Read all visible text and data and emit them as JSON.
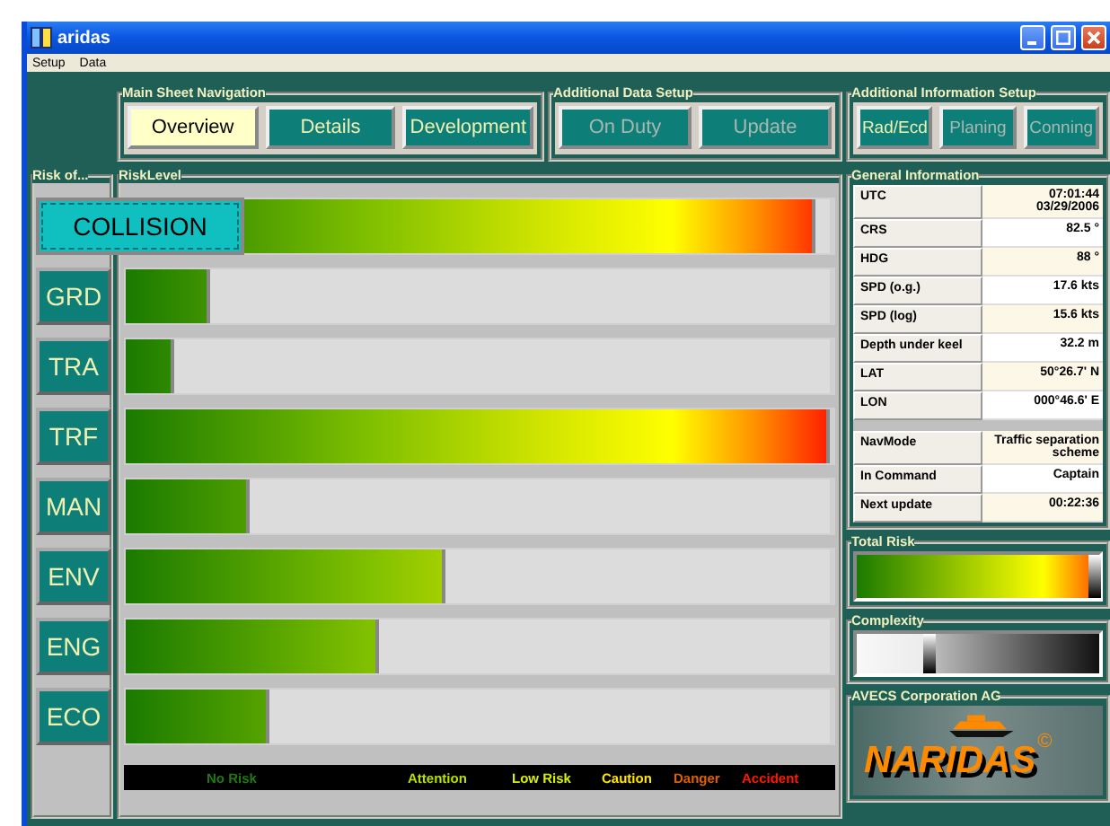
{
  "window": {
    "title": "aridas"
  },
  "menu": [
    "Setup",
    "Data"
  ],
  "nav_groups": [
    {
      "title": "Main Sheet Navigation",
      "buttons": [
        {
          "label": "Overview",
          "selected": true,
          "disabled": false
        },
        {
          "label": "Details",
          "selected": false,
          "disabled": false
        },
        {
          "label": "Development",
          "selected": false,
          "disabled": false
        }
      ]
    },
    {
      "title": "Additional Data Setup",
      "buttons": [
        {
          "label": "On Duty",
          "selected": false,
          "disabled": true
        },
        {
          "label": "Update",
          "selected": false,
          "disabled": true
        }
      ]
    },
    {
      "title": "Additional Information Setup",
      "buttons": [
        {
          "label": "Rad/Ecd",
          "selected": false,
          "disabled": false
        },
        {
          "label": "Planing",
          "selected": false,
          "disabled": true
        },
        {
          "label": "Conning",
          "selected": false,
          "disabled": true
        }
      ]
    }
  ],
  "risk_of": {
    "title": "Risk of..."
  },
  "risk_level": {
    "title": "RiskLevel"
  },
  "risks": [
    {
      "label": "COLLISION",
      "selected": true,
      "level": 0.98
    },
    {
      "label": "GRD",
      "selected": false,
      "level": 0.12
    },
    {
      "label": "TRA",
      "selected": false,
      "level": 0.07
    },
    {
      "label": "TRF",
      "selected": false,
      "level": 1.0
    },
    {
      "label": "MAN",
      "selected": false,
      "level": 0.175
    },
    {
      "label": "ENV",
      "selected": false,
      "level": 0.455
    },
    {
      "label": "ENG",
      "selected": false,
      "level": 0.36
    },
    {
      "label": "ECO",
      "selected": false,
      "level": 0.205
    }
  ],
  "legend": [
    {
      "label": "No Risk",
      "color": "#1f7a12"
    },
    {
      "label": "Attention",
      "color": "#b8e000"
    },
    {
      "label": "Low Risk",
      "color": "#d8f000"
    },
    {
      "label": "Caution",
      "color": "#ffe600"
    },
    {
      "label": "Danger",
      "color": "#e06000"
    },
    {
      "label": "Accident",
      "color": "#ff1a00"
    }
  ],
  "general_information": {
    "title": "General Information",
    "sections": [
      [
        {
          "label": "UTC",
          "value": "07:01:44 03/29/2006"
        },
        {
          "label": "CRS",
          "value": "82.5 °"
        },
        {
          "label": "HDG",
          "value": "88 °"
        },
        {
          "label": "SPD (o.g.)",
          "value": "17.6 kts"
        },
        {
          "label": "SPD (log)",
          "value": "15.6 kts"
        },
        {
          "label": "Depth under keel",
          "value": "32.2 m"
        },
        {
          "label": "LAT",
          "value": "50°26.7' N"
        },
        {
          "label": "LON",
          "value": "000°46.6' E"
        }
      ],
      [
        {
          "label": "NavMode",
          "value": "Traffic separation scheme"
        },
        {
          "label": "In Command",
          "value": "Captain"
        },
        {
          "label": "Next update",
          "value": "00:22:36"
        }
      ]
    ]
  },
  "total_risk": {
    "title": "Total Risk",
    "level": 0.96
  },
  "complexity": {
    "title": "Complexity",
    "level": 0.3
  },
  "company": {
    "title": "AVECS Corporation AG",
    "logo_text": "NARIDAS",
    "logo_mark": "©"
  }
}
